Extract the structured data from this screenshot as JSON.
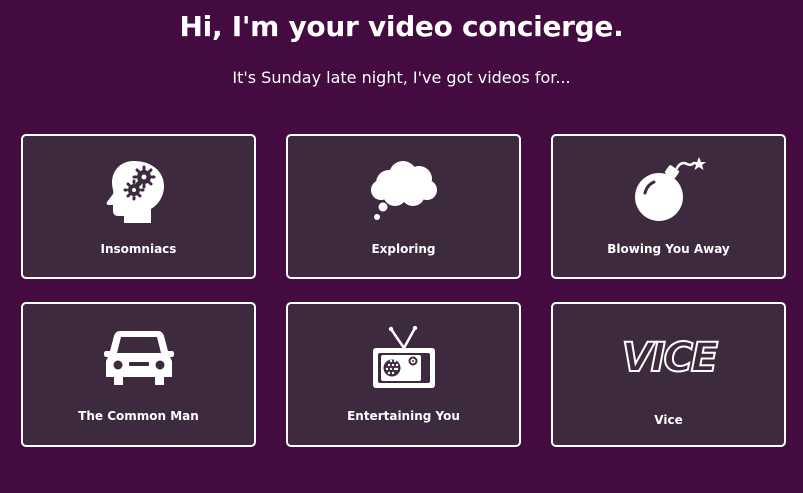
{
  "header": {
    "title": "Hi, I'm your video concierge.",
    "subtitle": "It's Sunday late night, I've got videos for..."
  },
  "tiles": [
    {
      "label": "Insomniacs",
      "icon": "head-gears-icon"
    },
    {
      "label": "Exploring",
      "icon": "thought-bubble-icon"
    },
    {
      "label": "Blowing You Away",
      "icon": "bomb-icon"
    },
    {
      "label": "The Common Man",
      "icon": "car-icon"
    },
    {
      "label": "Entertaining You",
      "icon": "tv-icon"
    },
    {
      "label": "Vice",
      "icon": "vice-logo",
      "logo_text": "VICE"
    }
  ],
  "colors": {
    "background": "#430b3f",
    "tile_background": "#3d2a3f",
    "tile_border": "#ffffff",
    "text": "#ffffff"
  }
}
